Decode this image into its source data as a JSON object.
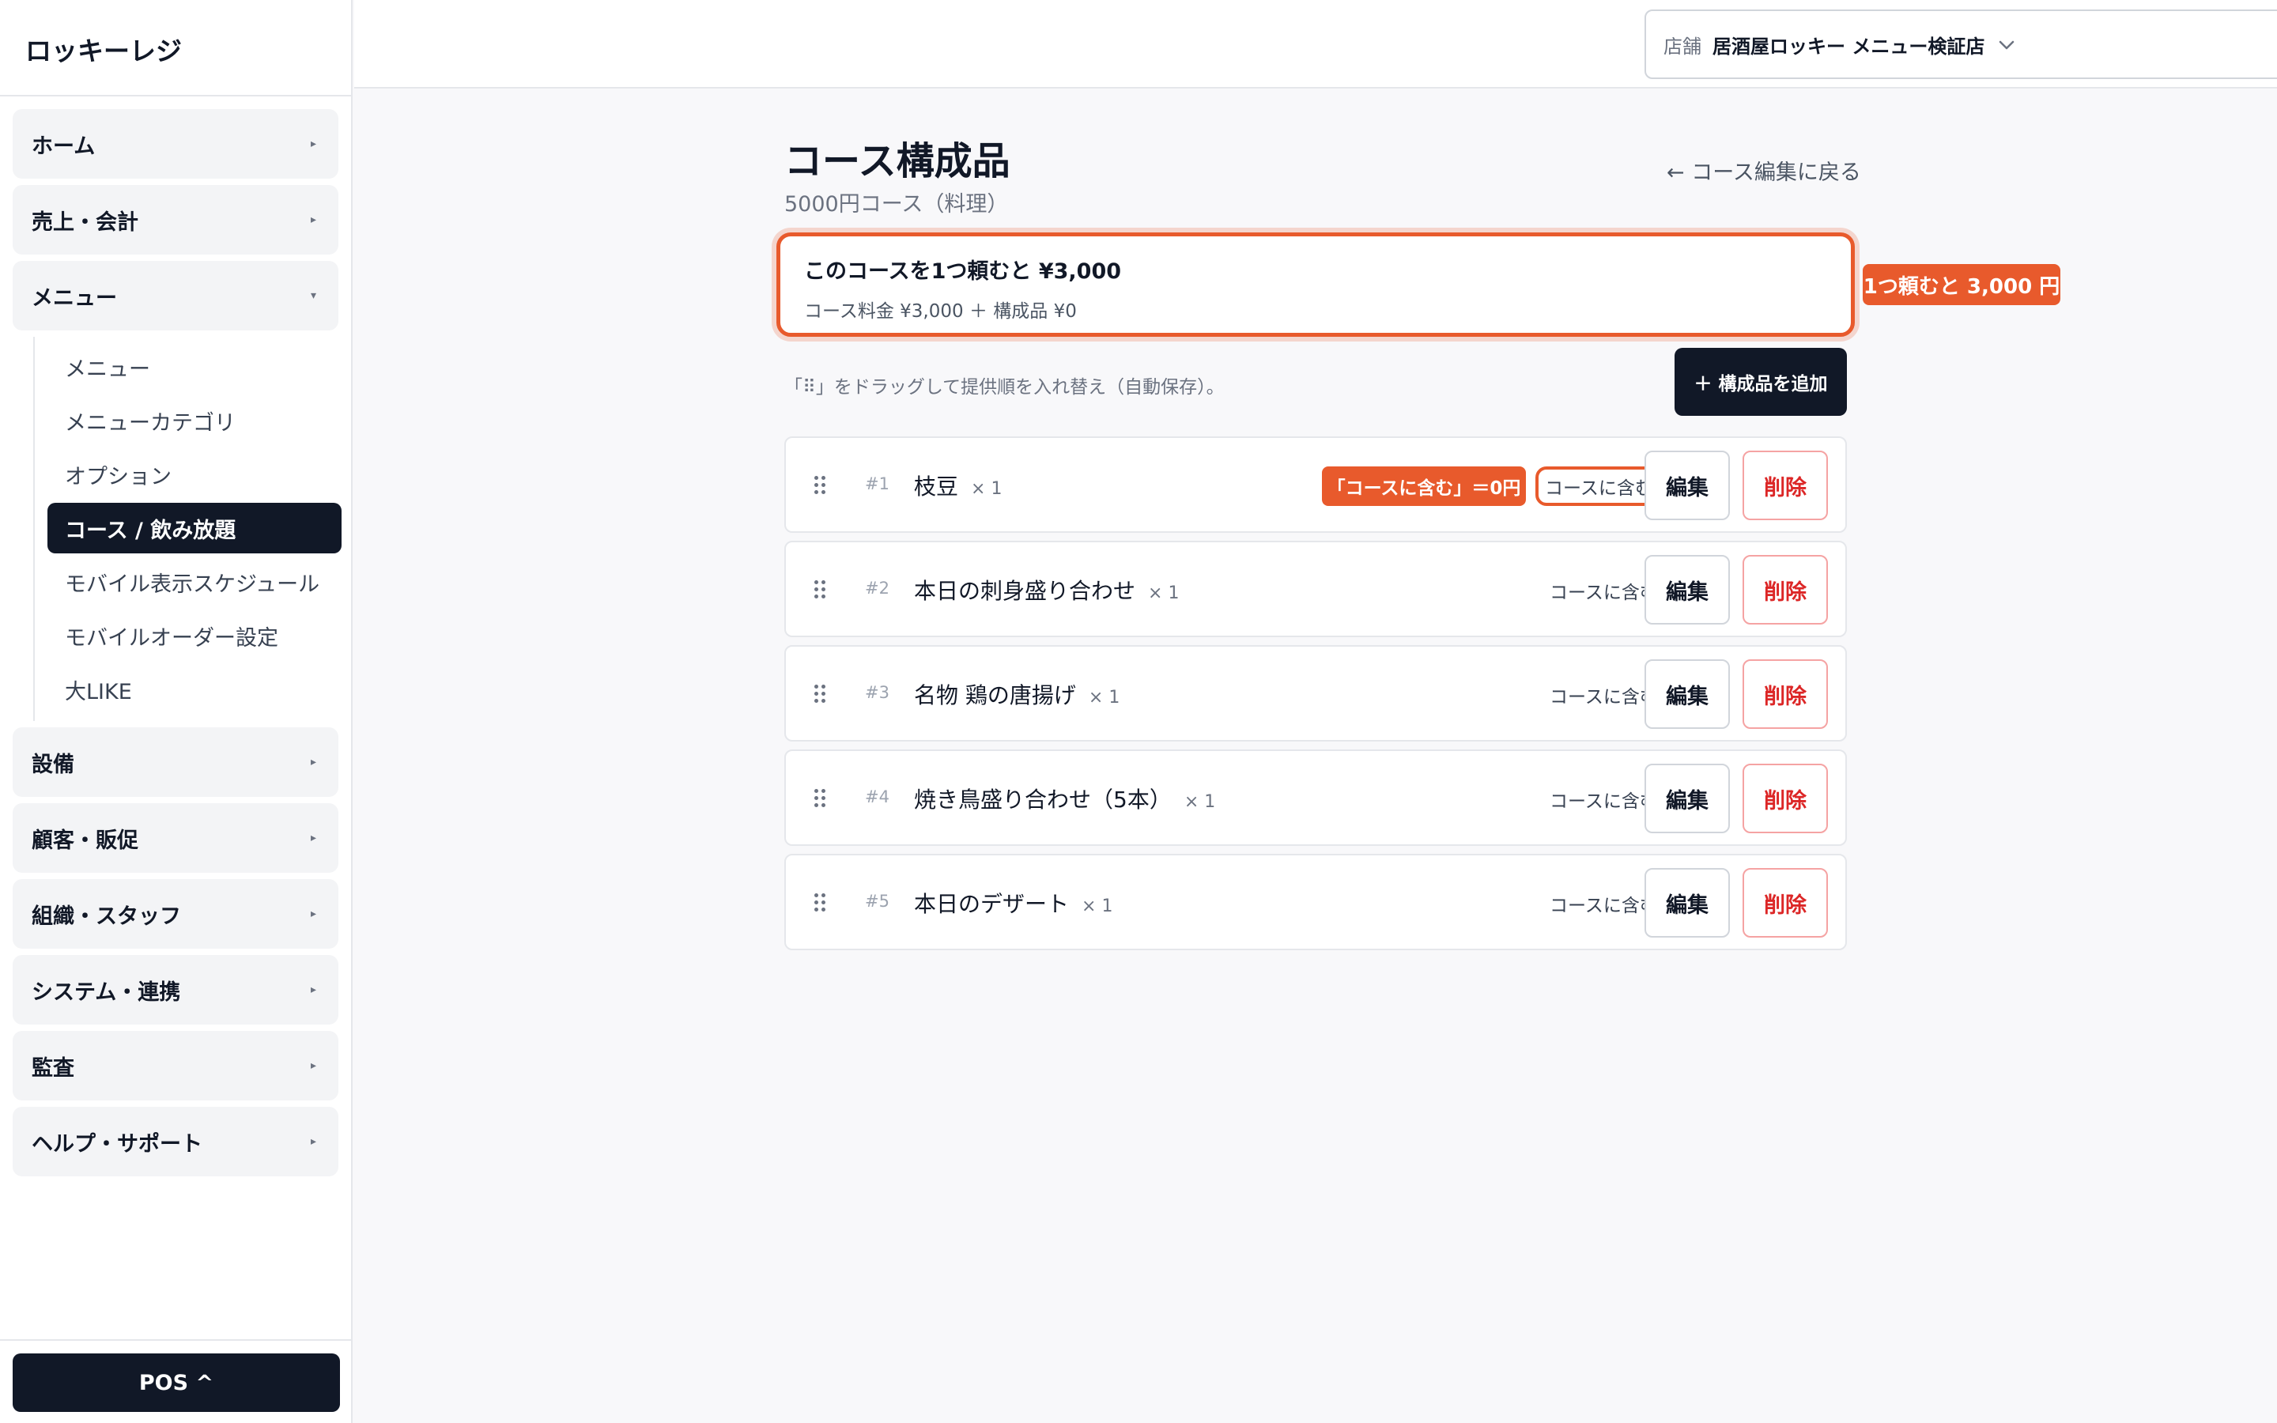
{
  "app": {
    "brand": "ロッキーレジ"
  },
  "sidebar": {
    "groups_top": [
      {
        "label": "ホーム",
        "caret": "▸"
      },
      {
        "label": "売上・会計",
        "caret": "▸"
      }
    ],
    "menu_group": {
      "label": "メニュー",
      "caret": "▾",
      "items": [
        {
          "label": "メニュー"
        },
        {
          "label": "メニューカテゴリ"
        },
        {
          "label": "オプション"
        },
        {
          "label": "コース / 飲み放題",
          "active": true
        },
        {
          "label": "モバイル表示スケジュール"
        },
        {
          "label": "モバイルオーダー設定"
        },
        {
          "label": "大LIKE"
        }
      ]
    },
    "groups_bottom": [
      {
        "label": "設備",
        "caret": "▸"
      },
      {
        "label": "顧客・販促",
        "caret": "▸"
      },
      {
        "label": "組織・スタッフ",
        "caret": "▸"
      },
      {
        "label": "システム・連携",
        "caret": "▸"
      },
      {
        "label": "監査",
        "caret": "▸"
      },
      {
        "label": "ヘルプ・サポート",
        "caret": "▸"
      }
    ],
    "pos_button": "POS ^"
  },
  "header": {
    "store_label": "店舗",
    "store_value": "居酒屋ロッキー メニュー検証店",
    "store_icon": "chevron-down-icon"
  },
  "main": {
    "title": "コース構成品",
    "subtitle": "5000円コース（料理）",
    "back_link": "← コース編集に戻る",
    "summary": {
      "title": "このコースを1つ頼むと ¥3,000",
      "detail": "コース料金 ¥3,000 ＋ 構成品 ¥0"
    },
    "summary_callout": "1つ頼むと 3,000 円",
    "hint": "「⠿」をドラッグして提供順を入れ替え（自動保存）。",
    "add_button": "＋ 構成品を追加",
    "row_callout": "「コースに含む」＝0円",
    "items": [
      {
        "num": "#1",
        "name": "枝豆",
        "qty": "× 1",
        "include": "コースに含む",
        "edit": "編集",
        "delete": "削除"
      },
      {
        "num": "#2",
        "name": "本日の刺身盛り合わせ",
        "qty": "× 1",
        "include": "コースに含む",
        "edit": "編集",
        "delete": "削除"
      },
      {
        "num": "#3",
        "name": "名物 鶏の唐揚げ",
        "qty": "× 1",
        "include": "コースに含む",
        "edit": "編集",
        "delete": "削除"
      },
      {
        "num": "#4",
        "name": "焼き鳥盛り合わせ（5本）",
        "qty": "× 1",
        "include": "コースに含む",
        "edit": "編集",
        "delete": "削除"
      },
      {
        "num": "#5",
        "name": "本日のデザート",
        "qty": "× 1",
        "include": "コースに含む",
        "edit": "編集",
        "delete": "削除"
      }
    ]
  },
  "colors": {
    "accent": "#e85a2c",
    "primary_dark": "#111827",
    "danger": "#dc2626"
  }
}
